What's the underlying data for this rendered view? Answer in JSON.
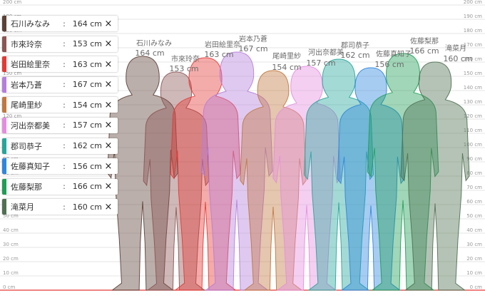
{
  "axis": {
    "ticks": [
      "0 cm",
      "10 cm",
      "20 cm",
      "30 cm",
      "40 cm",
      "50 cm",
      "60 cm",
      "70 cm",
      "80 cm",
      "90 cm",
      "100 cm",
      "110 cm",
      "120 cm",
      "130 cm",
      "140 cm",
      "150 cm",
      "160 cm",
      "170 cm",
      "180 cm",
      "190 cm",
      "200 cm"
    ],
    "min_cm": 0,
    "max_cm": 200,
    "baseline_color": "#e53935"
  },
  "close_icon": "×",
  "separator": ":",
  "people": [
    {
      "name": "石川みなみ",
      "height_cm": 164,
      "height_label": "164 cm",
      "color": "#5d4037"
    },
    {
      "name": "市來玲奈",
      "height_cm": 153,
      "height_label": "153 cm",
      "color": "#8d5555"
    },
    {
      "name": "岩田絵里奈",
      "height_cm": 163,
      "height_label": "163 cm",
      "color": "#e53935"
    },
    {
      "name": "岩本乃蒼",
      "height_cm": 167,
      "height_label": "167 cm",
      "color": "#b57edc"
    },
    {
      "name": "尾崎里紗",
      "height_cm": 154,
      "height_label": "154 cm",
      "color": "#c0783f"
    },
    {
      "name": "河出奈都美",
      "height_cm": 157,
      "height_label": "157 cm",
      "color": "#e48de0"
    },
    {
      "name": "郡司恭子",
      "height_cm": 162,
      "height_label": "162 cm",
      "color": "#26a69a"
    },
    {
      "name": "佐藤真知子",
      "height_cm": 156,
      "height_label": "156 cm",
      "color": "#2e86de"
    },
    {
      "name": "佐藤梨那",
      "height_cm": 166,
      "height_label": "166 cm",
      "color": "#1e9e56"
    },
    {
      "name": "滝菜月",
      "height_cm": 160,
      "height_label": "160 cm",
      "color": "#4f6f52"
    }
  ]
}
